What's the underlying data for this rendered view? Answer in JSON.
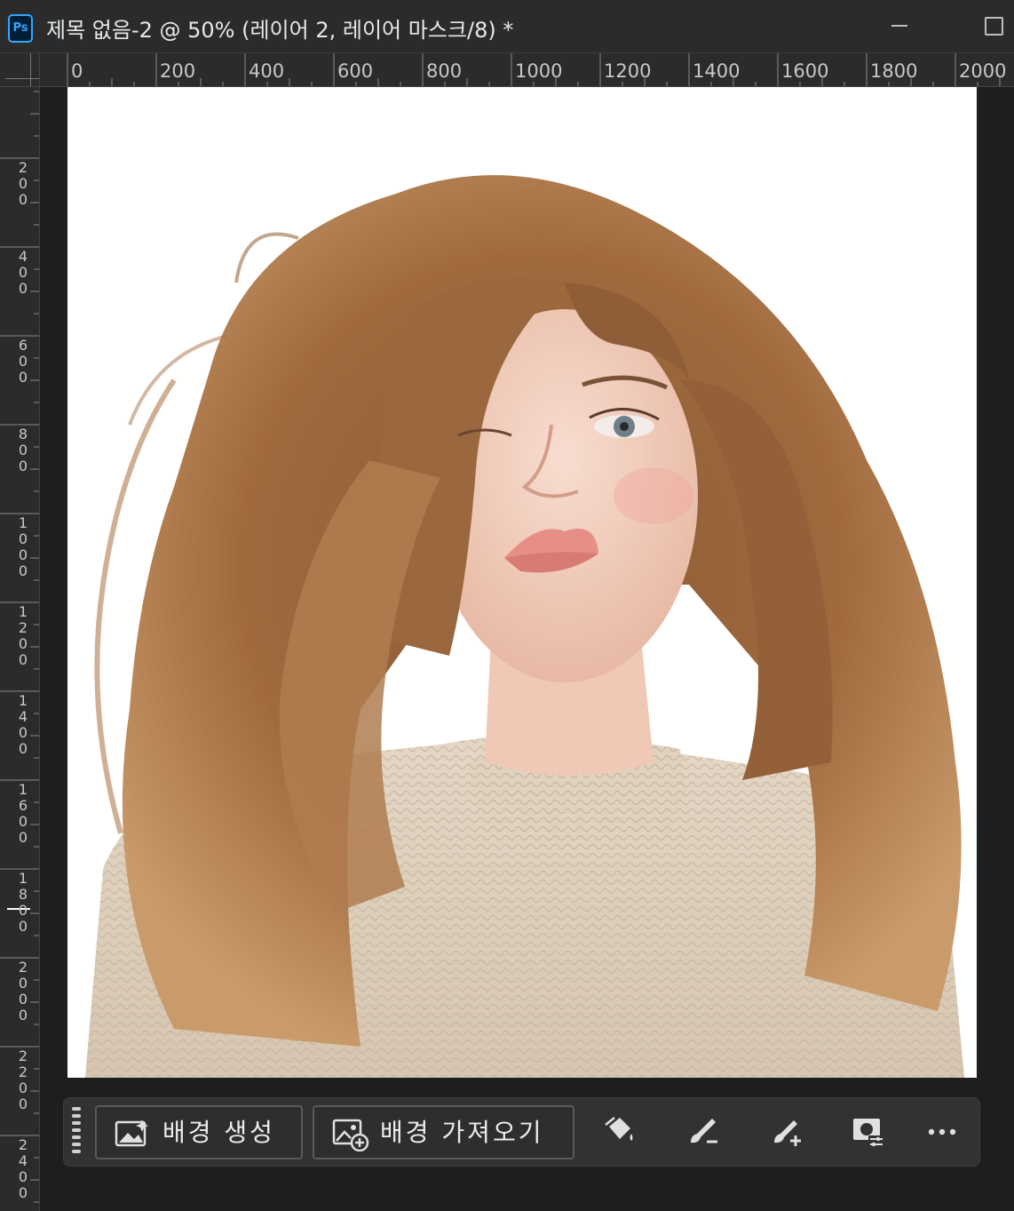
{
  "app": {
    "icon_text": "Ps",
    "document_title": "제목 없음-2 @ 50% (레이어 2, 레이어 마스크/8) *"
  },
  "rulers": {
    "horizontal_labels": [
      "0",
      "200",
      "400",
      "600",
      "800",
      "1000",
      "1200",
      "1400",
      "1600",
      "1800",
      "2000"
    ],
    "vertical_labels": [
      "200",
      "400",
      "600",
      "800",
      "1000",
      "1200",
      "1400",
      "1600",
      "1800",
      "2000",
      "2200",
      "2400"
    ]
  },
  "canvas": {
    "zoom": "50%",
    "layer": "레이어 2",
    "mode": "레이어 마스크/8",
    "background_color": "#ffffff",
    "image_subject": "portrait-photo"
  },
  "taskbar": {
    "generate_background_label": "배경 생성",
    "import_background_label": "배경 가져오기",
    "tools": [
      "fill-mask-icon",
      "subtract-brush-icon",
      "add-brush-icon",
      "mask-adjust-icon",
      "more-options-icon"
    ]
  },
  "colors": {
    "accent": "#31a8ff",
    "chrome": "#2b2b2b",
    "pasteboard": "#1e1e1e"
  }
}
